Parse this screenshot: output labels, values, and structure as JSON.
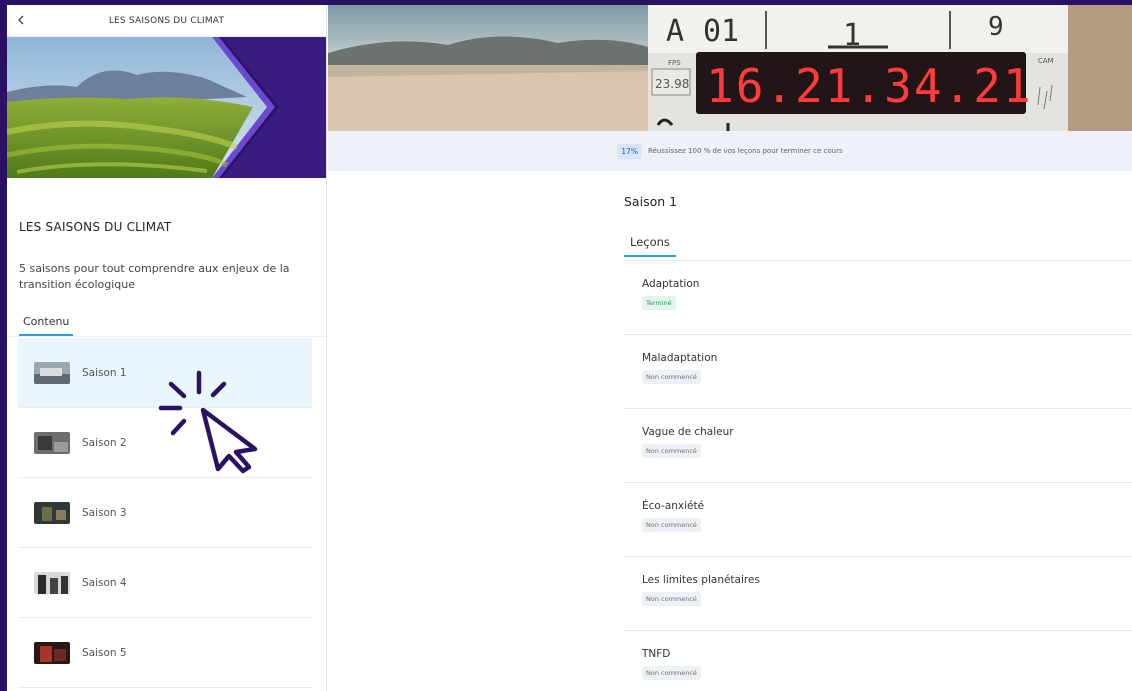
{
  "sidebar": {
    "header_title": "LES SAISONS DU CLIMAT",
    "course_title": "LES SAISONS DU CLIMAT",
    "course_description": "5 saisons pour tout comprendre aux enjeux de la transition écologique",
    "content_tab": "Contenu",
    "seasons": [
      {
        "label": "Saison 1",
        "active": true
      },
      {
        "label": "Saison 2",
        "active": false
      },
      {
        "label": "Saison 3",
        "active": false
      },
      {
        "label": "Saison 4",
        "active": false
      },
      {
        "label": "Saison 5",
        "active": false
      }
    ]
  },
  "hero": {
    "slate_scene": "A",
    "slate_roll": "01",
    "slate_take_left": "1",
    "slate_take": "9",
    "slate_fps_label": "FPS",
    "slate_fps": "23.98",
    "slate_timecode": "16.21.34.21",
    "slate_cam": "CAM"
  },
  "progress": {
    "percent": "17%",
    "message": "Réussissez 100 % de vos leçons pour terminer ce cours"
  },
  "main": {
    "season_title": "Saison 1",
    "lessons_tab": "Leçons",
    "lessons": [
      {
        "name": "Adaptation",
        "status": "Terminé",
        "done": true
      },
      {
        "name": "Maladaptation",
        "status": "Non commencé",
        "done": false
      },
      {
        "name": "Vague de chaleur",
        "status": "Non commencé",
        "done": false
      },
      {
        "name": "Éco-anxiété",
        "status": "Non commencé",
        "done": false
      },
      {
        "name": "Les limites planétaires",
        "status": "Non commencé",
        "done": false
      },
      {
        "name": "TNFD",
        "status": "Non commencé",
        "done": false
      }
    ]
  },
  "colors": {
    "frame": "#2a1163",
    "accent": "#2d9cdb",
    "active_row": "#e9f6fd",
    "timecode": "#ff3b3b"
  }
}
